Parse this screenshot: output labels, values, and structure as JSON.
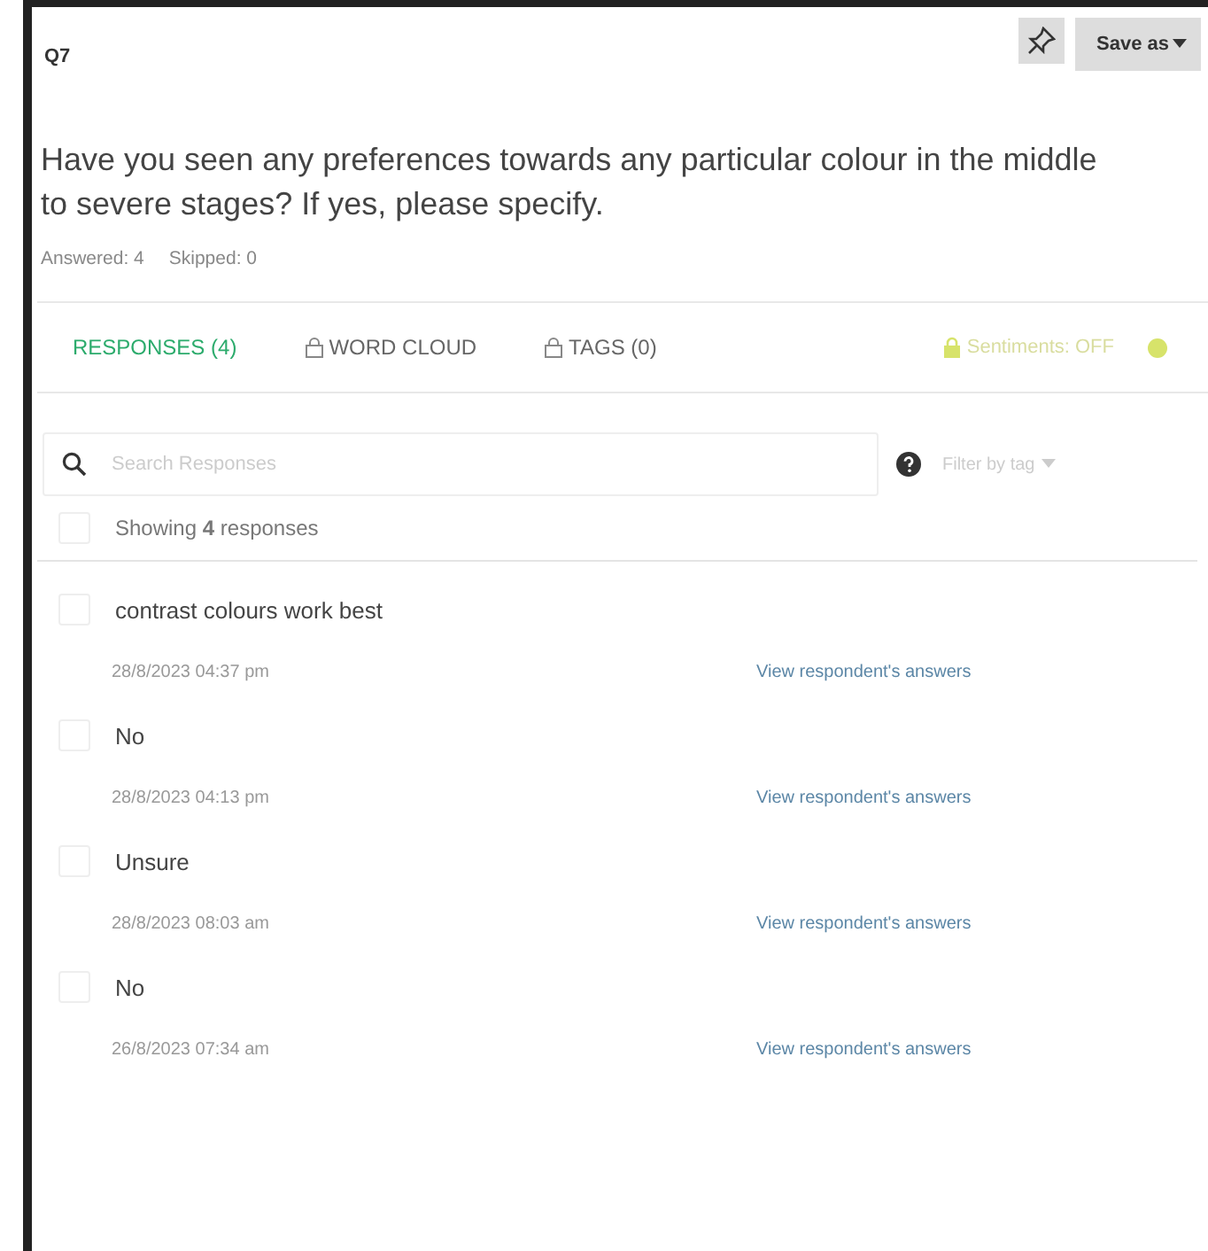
{
  "question": {
    "number": "Q7",
    "text": "Have you seen any preferences towards any particular colour in the middle to severe stages? If yes, please specify.",
    "answered": "Answered: 4",
    "skipped": "Skipped: 0"
  },
  "toolbar": {
    "save": "Save as"
  },
  "tabs": [
    {
      "label": "RESPONSES (4)",
      "selected": true,
      "locked": false
    },
    {
      "label": "WORD CLOUD",
      "selected": false,
      "locked": true
    },
    {
      "label": "TAGS (0)",
      "selected": false,
      "locked": true
    }
  ],
  "sentiments": {
    "label": "Sentiments: OFF",
    "on": false
  },
  "search": {
    "placeholder": "Search Responses"
  },
  "filter": {
    "placeholder": "Filter by tag"
  },
  "summary": {
    "text": "Showing **4** responses",
    "checked": false
  },
  "responses": [
    {
      "text": "contrast colours work best",
      "date": "28/8/2023 04:37 pm",
      "link": "View respondent's answers",
      "checked": false
    },
    {
      "text": "No",
      "date": "28/8/2023 04:13 pm",
      "link": "View respondent's answers",
      "checked": false
    },
    {
      "text": "Unsure",
      "date": "28/8/2023 08:03 am",
      "link": "View respondent's answers",
      "checked": false
    },
    {
      "text": "No",
      "date": "26/8/2023 07:34 am",
      "link": "View respondent's answers",
      "checked": false
    }
  ]
}
